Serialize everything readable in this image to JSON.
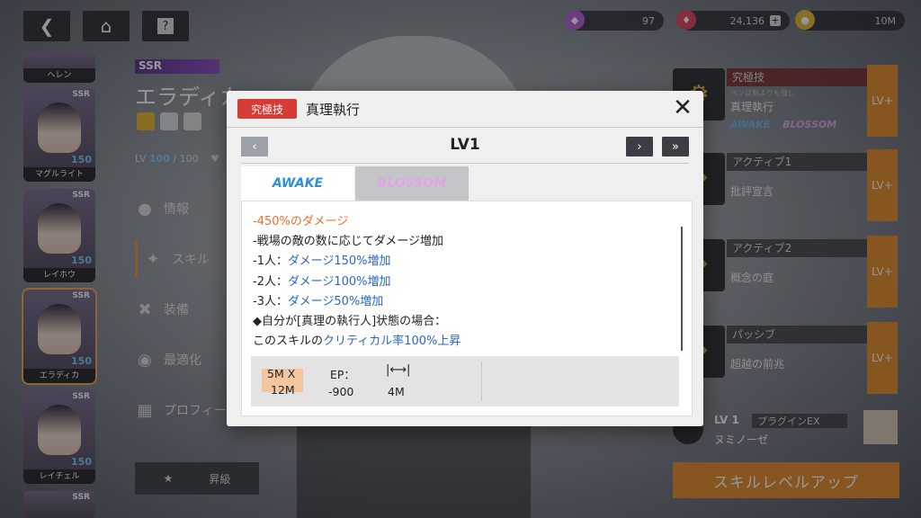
{
  "top": {
    "resources": [
      {
        "icon": "gem-icon",
        "value": "97",
        "color": "#b55bd6"
      },
      {
        "icon": "crystal-icon",
        "value": "24,136",
        "color": "#e0405a"
      },
      {
        "icon": "coin-icon",
        "value": "10M",
        "color": "#e7b62f"
      }
    ]
  },
  "character": {
    "rarity": "SSR",
    "name": "エラディカ",
    "level_label": "LV",
    "level": "100",
    "level_max": "/ 100"
  },
  "roster": [
    {
      "name": "ヘレン",
      "rarity": "",
      "level": ""
    },
    {
      "name": "マグルライト",
      "rarity": "SSR",
      "level": "150"
    },
    {
      "name": "レイホウ",
      "rarity": "SSR",
      "level": "150"
    },
    {
      "name": "エラディカ",
      "rarity": "SSR",
      "level": "150"
    },
    {
      "name": "レイチェル",
      "rarity": "SSR",
      "level": "150"
    },
    {
      "name": "",
      "rarity": "SSR",
      "level": ""
    }
  ],
  "menu": [
    {
      "label": "情報",
      "icon": "head-icon"
    },
    {
      "label": "スキル",
      "icon": "skill-icon"
    },
    {
      "label": "装備",
      "icon": "swords-icon"
    },
    {
      "label": "最適化",
      "icon": "optimize-icon"
    },
    {
      "label": "プロフィー",
      "icon": "profile-icon"
    }
  ],
  "ascend_label": "昇級",
  "skills": [
    {
      "type": "究極技",
      "name": "真理執行",
      "sub": "ペンは剣よりも強し",
      "lvplus": "LV+"
    },
    {
      "type": "アクティブ1",
      "name": "批評宣言",
      "lvplus": "LV+"
    },
    {
      "type": "アクティブ2",
      "name": "概念の庭",
      "lvplus": "LV+"
    },
    {
      "type": "パッシブ",
      "name": "超越の前兆",
      "lvplus": "LV+"
    }
  ],
  "skill_tabs_mini": [
    "AWAKE",
    "BLOSSOM"
  ],
  "plugin": {
    "level": "LV 1",
    "type": "プラグインEX",
    "name": "ヌミノーゼ"
  },
  "upgrade_label": "スキルレベルアップ",
  "modal": {
    "badge": "究極技",
    "title": "真理執行",
    "level": "LV1",
    "tabs": [
      "AWAKE",
      "BLOSSOM"
    ],
    "lines": [
      {
        "parts": [
          {
            "t": "-",
            "c": "o"
          },
          {
            "t": "450%のダメージ",
            "c": "o"
          }
        ]
      },
      {
        "parts": [
          {
            "t": "-戦場の敵の数に応じてダメージ増加",
            "c": ""
          }
        ]
      },
      {
        "parts": [
          {
            "t": "-1人：",
            "c": ""
          },
          {
            "t": "ダメージ150%増加",
            "c": "b"
          }
        ]
      },
      {
        "parts": [
          {
            "t": "-2人：",
            "c": ""
          },
          {
            "t": "ダメージ100%増加",
            "c": "b"
          }
        ]
      },
      {
        "parts": [
          {
            "t": "-3人：",
            "c": ""
          },
          {
            "t": "ダメージ50%増加",
            "c": "b"
          }
        ]
      },
      {
        "parts": [
          {
            "t": "◆自分が[真理の執行人]状態の場合：",
            "c": ""
          }
        ]
      },
      {
        "parts": [
          {
            "t": "このスキルの",
            "c": ""
          },
          {
            "t": "クリティカル率100%上昇",
            "c": "b"
          }
        ]
      }
    ],
    "stats": {
      "area_top": "5M X",
      "area_bottom": "12M",
      "ep_label": "EP：",
      "ep_value": "-900",
      "range_value": "4M"
    }
  }
}
